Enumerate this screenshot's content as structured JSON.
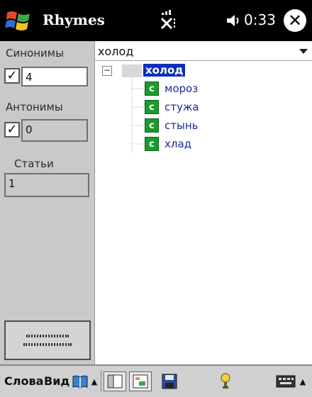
{
  "titlebar": {
    "app_title": "Rhymes",
    "clock": "0:33",
    "close_glyph": "✕",
    "icons": [
      "windows-start-flag-icon",
      "signal-icon",
      "speaker-icon"
    ]
  },
  "left_panel": {
    "synonyms_label": "Синонимы",
    "synonyms_checked": true,
    "synonyms_count": "4",
    "antonyms_label": "Антонимы",
    "antonyms_checked": true,
    "antonyms_count": "0",
    "articles_label": "Статьи",
    "articles_count": "1",
    "checkmark": "✓"
  },
  "search": {
    "value": "холод"
  },
  "tree": {
    "expander": "−",
    "root": "холод",
    "child_badge": "c",
    "children": [
      "мороз",
      "стужа",
      "стынь",
      "хлад"
    ]
  },
  "menubar": {
    "menu_words": "Слова",
    "menu_view": "Вид",
    "up_glyph": "▲"
  },
  "colors": {
    "titlebar_bg": "#000000",
    "panel_bg": "#c9c9c9",
    "selection_bg": "#0b2fbd",
    "synonym_badge": "#1a9b2e"
  }
}
